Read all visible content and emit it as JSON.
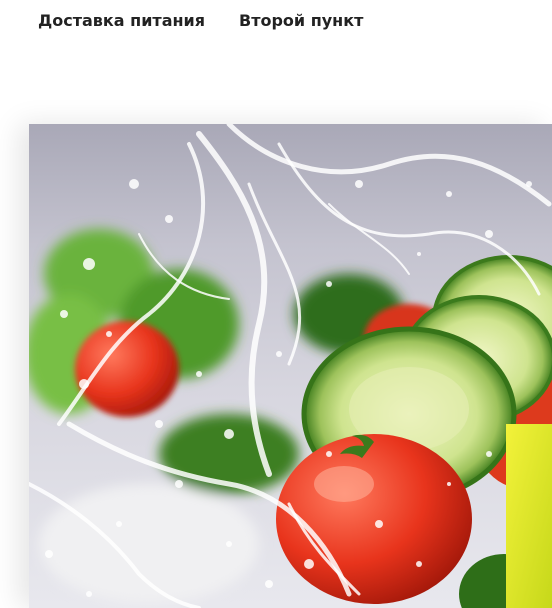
{
  "nav": {
    "items": [
      {
        "label": "Доставка питания"
      },
      {
        "label": "Второй пункт"
      }
    ],
    "accent_color": "#44e04e"
  },
  "hero": {
    "icon": "salad-vegetables-water-splash-photo"
  }
}
